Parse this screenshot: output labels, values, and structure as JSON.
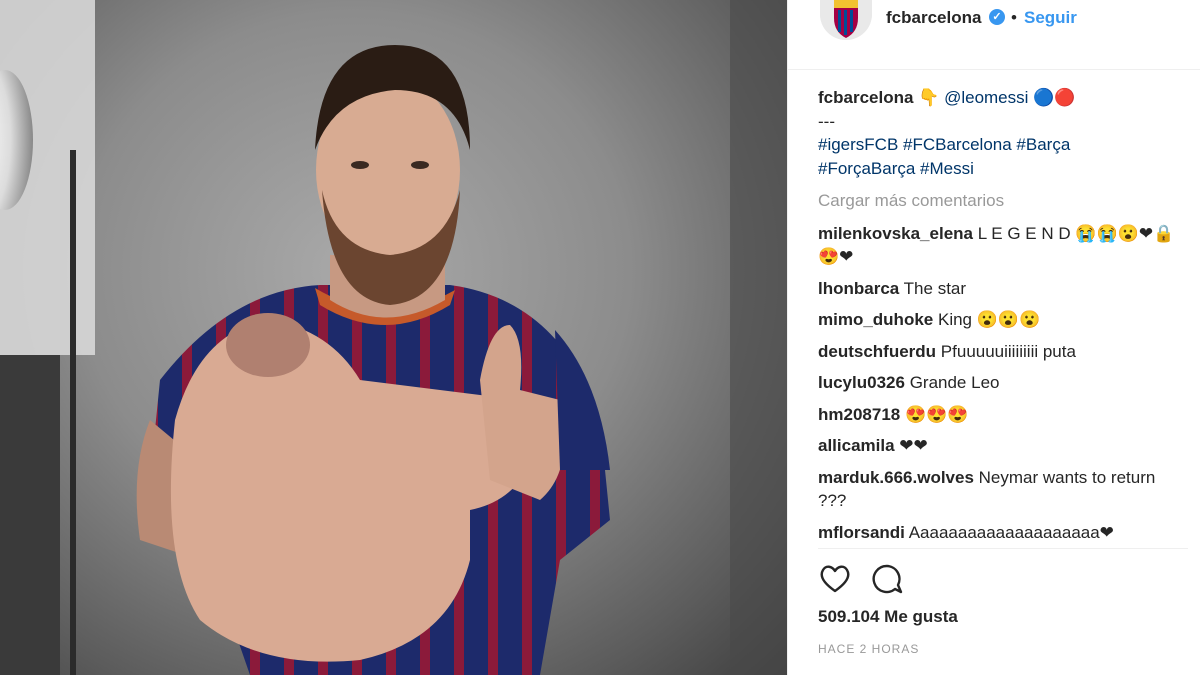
{
  "header": {
    "username": "fcbarcelona",
    "separator": "•",
    "follow_label": "Seguir"
  },
  "caption": {
    "username": "fcbarcelona",
    "emoji_point": "👇",
    "mention": "@leomessi",
    "emoji_balls": "🔵🔴",
    "separator": "---",
    "tags_line1": "#igersFCB #FCBarcelona #Barça",
    "tags_line2": "#ForçaBarça #Messi"
  },
  "load_more_label": "Cargar más comentarios",
  "comments": [
    {
      "user": "milenkovska_elena",
      "text": "L E G E N D 😭😭😮❤🔒😍❤"
    },
    {
      "user": "lhonbarca",
      "text": "The star"
    },
    {
      "user": "mimo_duhoke",
      "text": "King 😮😮😮"
    },
    {
      "user": "deutschfuerdu",
      "text": "Pfuuuuuiiiiiiiii puta"
    },
    {
      "user": "lucylu0326",
      "text": "Grande Leo"
    },
    {
      "user": "hm208718",
      "text": "😍😍😍"
    },
    {
      "user": "allicamila",
      "text": "❤❤"
    },
    {
      "user": "marduk.666.wolves",
      "text": "Neymar wants to return ???"
    },
    {
      "user": "mflorsandi",
      "text": "Aaaaaaaaaaaaaaaaaaaa❤"
    }
  ],
  "actions": {
    "like_icon": "heart-icon",
    "comment_icon": "comment-icon"
  },
  "likes_label": "509.104 Me gusta",
  "time_label": "HACE 2 HORAS",
  "colors": {
    "link_blue": "#003569",
    "follow_blue": "#3897f0",
    "muted": "#999999",
    "text": "#262626"
  }
}
